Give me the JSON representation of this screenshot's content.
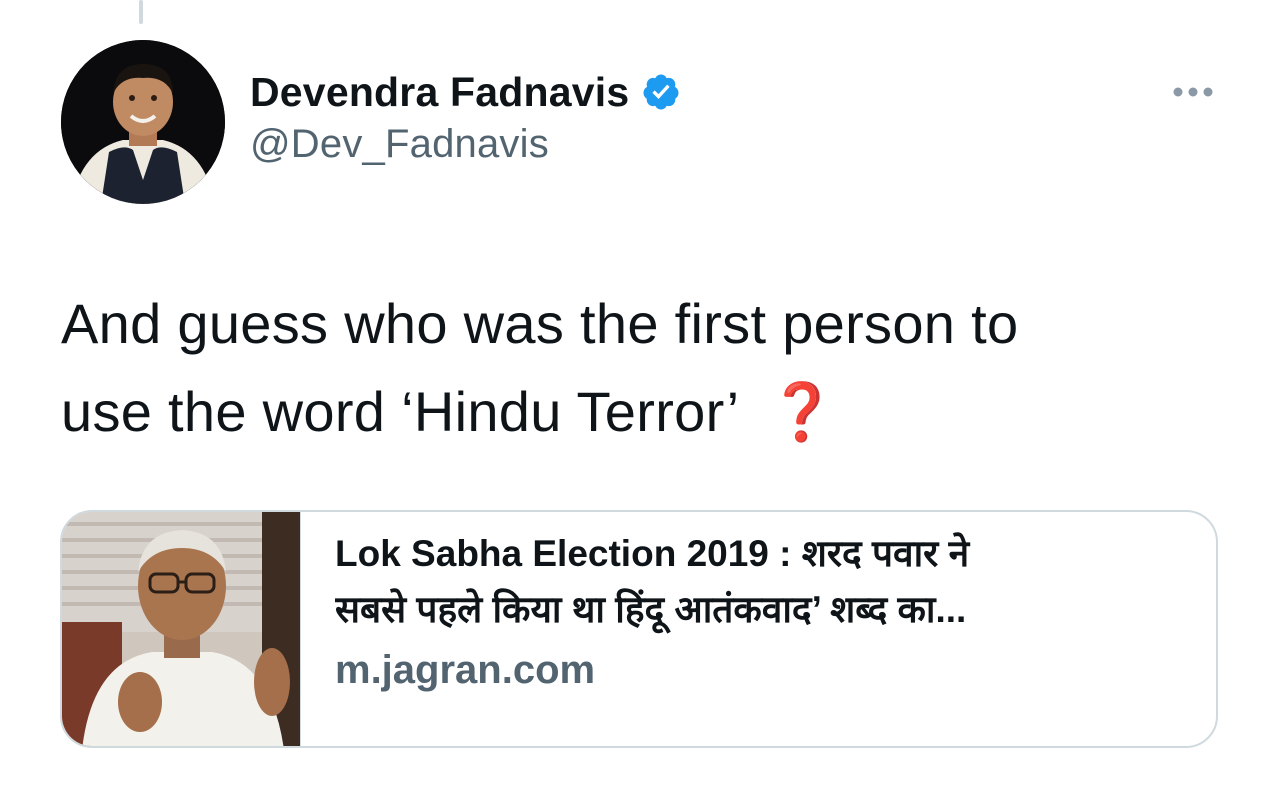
{
  "tweet": {
    "author": {
      "display_name": "Devendra Fadnavis",
      "handle": "@Dev_Fadnavis",
      "verified": true,
      "avatar_icon": "profile-photo"
    },
    "text_line1": "And guess who was the first person to",
    "text_line2": "use the word ‘Hindu Terror’",
    "emoji": "❓",
    "more_icon": "more-horizontal-icon"
  },
  "link_card": {
    "title_line1": "Lok Sabha Election 2019 : शरद पवार ने",
    "title_line2": "सबसे पहले किया था हिंदू आतंकवाद’ शब्द का...",
    "domain": "m.jagran.com",
    "thumbnail_icon": "article-thumbnail-photo"
  },
  "colors": {
    "text_primary": "#0f1419",
    "text_secondary": "#536471",
    "verified_blue": "#1d9bf0",
    "border": "#cfd9de",
    "emoji_red": "#d90f1a"
  }
}
